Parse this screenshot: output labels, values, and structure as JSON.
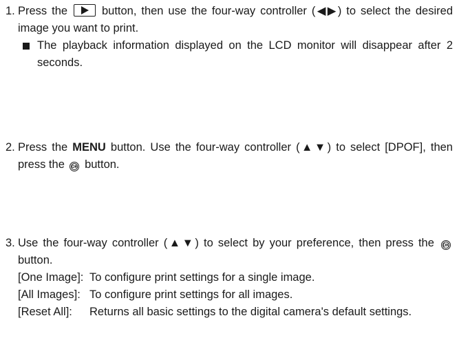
{
  "steps": [
    {
      "num": "1.",
      "a": "Press the",
      "b": "button, then use the four-way controller (◀▶) to select the desired image you want to print.",
      "bullet": "The playback information displayed on the LCD monitor will disappear after 2 seconds."
    },
    {
      "num": "2.",
      "a": "Press the",
      "menu": "MENU",
      "b": "button. Use the four-way controller (▲▼) to select [DPOF], then press the",
      "c": "button."
    },
    {
      "num": "3.",
      "a": "Use the four-way controller (▲▼) to select by your preference, then press the",
      "b": "button.",
      "options": [
        {
          "key": "[One Image]:",
          "desc": "To configure print settings for a single image."
        },
        {
          "key": "[All Images]:",
          "desc": "To configure print settings for all images."
        },
        {
          "key": "[Reset All]:",
          "desc": "Returns all basic settings to the digital camera's default settings."
        }
      ]
    }
  ],
  "icons": {
    "ok_label": "OK"
  }
}
